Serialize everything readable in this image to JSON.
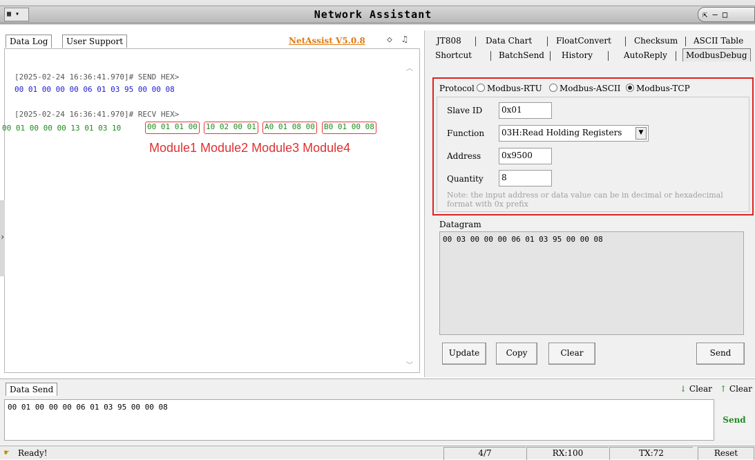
{
  "window": {
    "title": "Network Assistant",
    "app_icon": "network-icon",
    "controls": "⇱ ‒ □"
  },
  "left": {
    "tabs": [
      "Data Log",
      "User Support"
    ],
    "version": "NetAssist V5.0.8",
    "log": [
      {
        "text": "[2025-02-24 16:36:41.970]# SEND HEX>",
        "color": "#555555"
      },
      {
        "text": "00 01 00 00 00 06 01 03 95 00 00 08",
        "color": "#1c1cd0"
      },
      {
        "text": "[2025-02-24 16:36:41.970]# RECV HEX>",
        "color": "#555555"
      },
      {
        "text": "00 01 00 00 00 13 01 03 10",
        "color": "#1a8c1a"
      }
    ],
    "recv_modules": [
      "00 01 01 00",
      "10 02 00 01",
      "A0 01 08 00",
      "B0 01 00 08"
    ],
    "module_labels": "Module1 Module2 Module3 Module4"
  },
  "right": {
    "tabs_row1": [
      "JT808",
      "Data Chart",
      "FloatConvert",
      "Checksum",
      "ASCII Table"
    ],
    "tabs_row2": [
      "Shortcut",
      "BatchSend",
      "History",
      "AutoReply",
      "ModbusDebug"
    ],
    "active_tab": "ModbusDebug",
    "protocol": {
      "label": "Protocol",
      "options": [
        "Modbus-RTU",
        "Modbus-ASCII",
        "Modbus-TCP"
      ],
      "selected": "Modbus-TCP"
    },
    "slave_id": {
      "label": "Slave ID",
      "value": "0x01"
    },
    "function": {
      "label": "Function",
      "value": "03H:Read Holding Registers"
    },
    "address": {
      "label": "Address",
      "value": "0x9500"
    },
    "quantity": {
      "label": "Quantity",
      "value": "8"
    },
    "note": "Note: the input address or data value can be in decimal or hexadecimal format with 0x prefix",
    "datagram": {
      "label": "Datagram",
      "value": "00 03 00 00 00 06 01 03 95 00 00 08"
    },
    "buttons": {
      "update": "Update",
      "copy": "Copy",
      "clear": "Clear",
      "send": "Send"
    }
  },
  "send": {
    "tab": "Data Send",
    "clear1": "Clear",
    "clear2": "Clear",
    "value": "00 01 00 00 00 06 01 03 95 00 00 08",
    "send_label": "Send"
  },
  "status": {
    "ready": "Ready!",
    "count": "4/7",
    "rx": "RX:100",
    "tx": "TX:72",
    "reset": "Reset"
  }
}
